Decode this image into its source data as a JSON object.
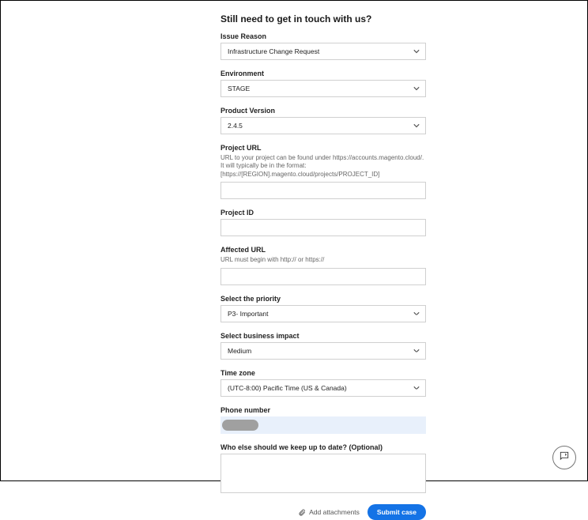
{
  "title": "Still need to get in touch with us?",
  "fields": {
    "issueReason": {
      "label": "Issue Reason",
      "value": "Infrastructure Change Request"
    },
    "environment": {
      "label": "Environment",
      "value": "STAGE"
    },
    "productVersion": {
      "label": "Product Version",
      "value": "2.4.5"
    },
    "projectUrl": {
      "label": "Project URL",
      "help": "URL to your project can be found under https://accounts.magento.cloud/. It will typically be in the format: [https://[REGION].magento.cloud/projects/PROJECT_ID]",
      "value": ""
    },
    "projectId": {
      "label": "Project ID",
      "value": ""
    },
    "affectedUrl": {
      "label": "Affected URL",
      "help": "URL must begin with http:// or https://",
      "value": ""
    },
    "priority": {
      "label": "Select the priority",
      "value": "P3- Important"
    },
    "businessImpact": {
      "label": "Select business impact",
      "value": "Medium"
    },
    "timeZone": {
      "label": "Time zone",
      "value": "(UTC-8:00) Pacific Time (US & Canada)"
    },
    "phone": {
      "label": "Phone number"
    },
    "keepUpToDate": {
      "label": "Who else should we keep up to date? (Optional)",
      "value": ""
    }
  },
  "actions": {
    "addAttachments": "Add attachments",
    "submit": "Submit case"
  }
}
